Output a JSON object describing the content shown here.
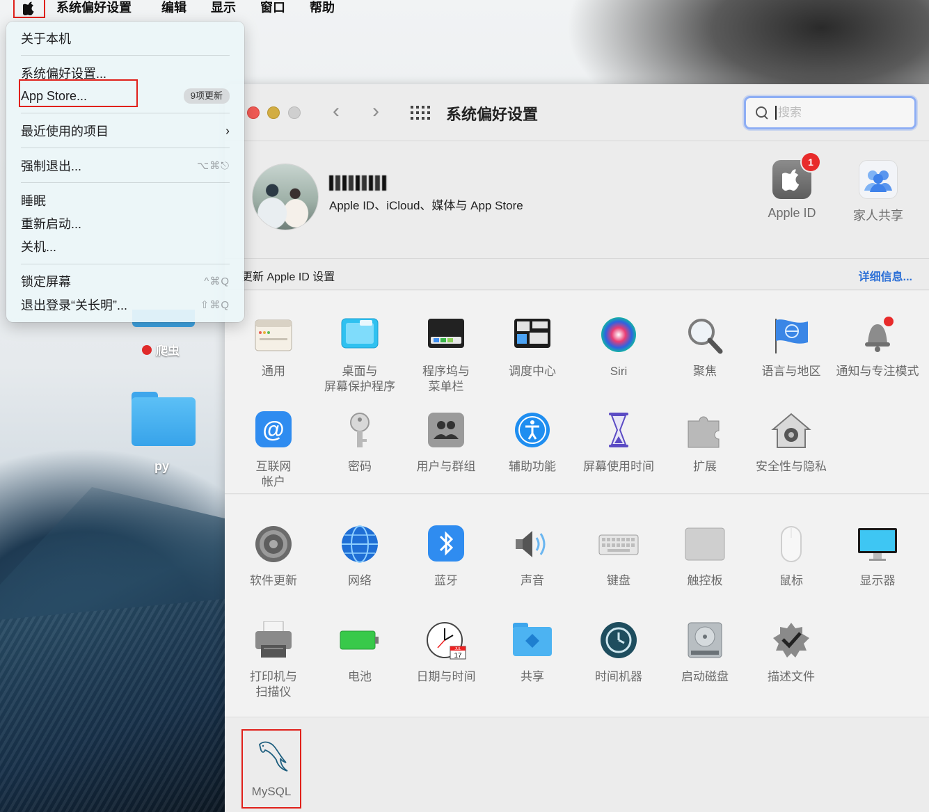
{
  "menubar": {
    "apple_icon": "apple-logo-icon",
    "items": [
      "系统偏好设置",
      "编辑",
      "显示",
      "窗口",
      "帮助"
    ]
  },
  "apple_menu": {
    "about": "关于本机",
    "system_prefs": "系统偏好设置...",
    "app_store": "App Store...",
    "app_store_badge": "9项更新",
    "recent_items": "最近使用的项目",
    "force_quit": "强制退出...",
    "force_quit_shortcut": "⌥⌘⎋",
    "sleep": "睡眠",
    "restart": "重新启动...",
    "shutdown": "关机...",
    "lock_screen": "锁定屏幕",
    "lock_screen_shortcut": "^⌘Q",
    "logout": "退出登录“关长明”...",
    "logout_shortcut": "⇧⌘Q"
  },
  "desktop": {
    "icon1_label": "爬虫",
    "folder_label": "py"
  },
  "window": {
    "title": "系统偏好设置",
    "search_placeholder": "搜索",
    "account_subtitle": "Apple ID、iCloud、媒体与 App Store",
    "apple_id_label": "Apple ID",
    "apple_id_badge": "1",
    "family_label": "家人共享",
    "update_text": "更新 Apple ID 设置",
    "update_link": "详细信息..."
  },
  "section1": [
    {
      "label": "通用",
      "icon": "general-icon"
    },
    {
      "label": "桌面与\n屏幕保护程序",
      "icon": "desktop-screensaver-icon"
    },
    {
      "label": "程序坞与\n菜单栏",
      "icon": "dock-menubar-icon"
    },
    {
      "label": "调度中心",
      "icon": "mission-control-icon"
    },
    {
      "label": "Siri",
      "icon": "siri-icon"
    },
    {
      "label": "聚焦",
      "icon": "spotlight-icon"
    },
    {
      "label": "语言与地区",
      "icon": "language-region-icon"
    },
    {
      "label": "通知与专注模式",
      "icon": "notifications-icon"
    },
    {
      "label": "互联网\n帐户",
      "icon": "internet-accounts-icon"
    },
    {
      "label": "密码",
      "icon": "passwords-icon"
    },
    {
      "label": "用户与群组",
      "icon": "users-groups-icon"
    },
    {
      "label": "辅助功能",
      "icon": "accessibility-icon"
    },
    {
      "label": "屏幕使用时间",
      "icon": "screen-time-icon"
    },
    {
      "label": "扩展",
      "icon": "extensions-icon"
    },
    {
      "label": "安全性与隐私",
      "icon": "security-privacy-icon"
    }
  ],
  "section2": [
    {
      "label": "软件更新",
      "icon": "software-update-icon"
    },
    {
      "label": "网络",
      "icon": "network-icon"
    },
    {
      "label": "蓝牙",
      "icon": "bluetooth-icon"
    },
    {
      "label": "声音",
      "icon": "sound-icon"
    },
    {
      "label": "键盘",
      "icon": "keyboard-icon"
    },
    {
      "label": "触控板",
      "icon": "trackpad-icon"
    },
    {
      "label": "鼠标",
      "icon": "mouse-icon"
    },
    {
      "label": "显示器",
      "icon": "displays-icon"
    },
    {
      "label": "打印机与\n扫描仪",
      "icon": "printers-icon"
    },
    {
      "label": "电池",
      "icon": "battery-icon"
    },
    {
      "label": "日期与时间",
      "icon": "date-time-icon"
    },
    {
      "label": "共享",
      "icon": "sharing-icon"
    },
    {
      "label": "时间机器",
      "icon": "time-machine-icon"
    },
    {
      "label": "启动磁盘",
      "icon": "startup-disk-icon"
    },
    {
      "label": "描述文件",
      "icon": "profiles-icon"
    }
  ],
  "section3": [
    {
      "label": "MySQL",
      "icon": "mysql-dolphin-icon"
    }
  ],
  "calendar_icon_text": {
    "month": "JUL",
    "day": "17"
  },
  "colors": {
    "highlight_red": "#e0201a",
    "link_blue": "#2b6fd6",
    "badge_red": "#e82b2b"
  }
}
